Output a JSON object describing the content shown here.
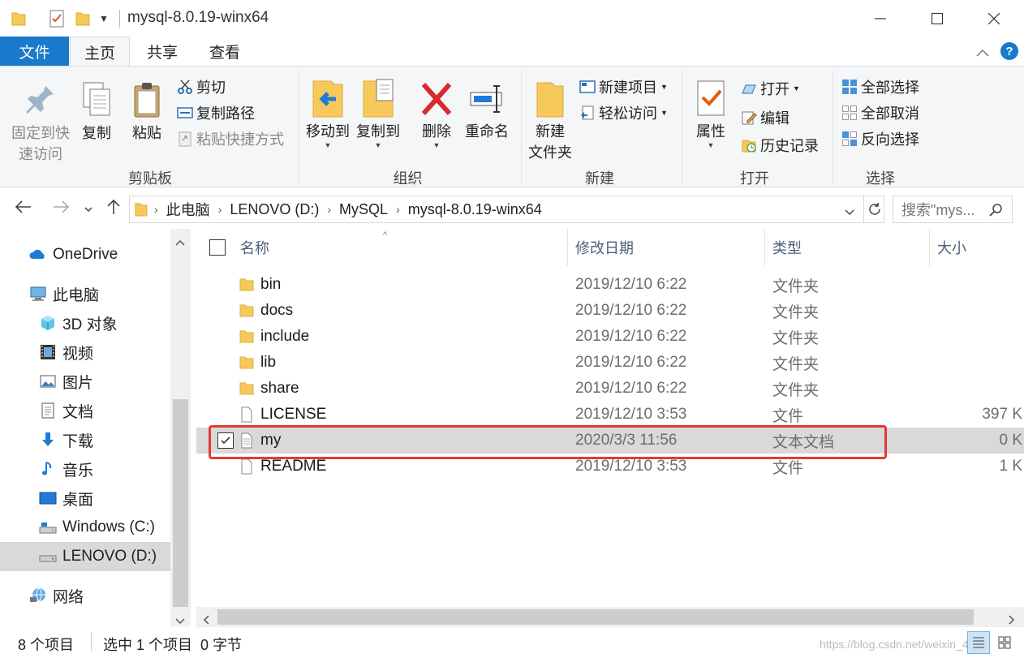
{
  "window": {
    "title": "mysql-8.0.19-winx64",
    "minimize_glyph": "—",
    "maximize_glyph": "☐",
    "close_glyph": "✕"
  },
  "tabs": {
    "file": "文件",
    "home": "主页",
    "share": "共享",
    "view": "查看",
    "help": "?"
  },
  "ribbon": {
    "clipboard": {
      "label": "剪贴板",
      "pin_line1": "固定到快",
      "pin_line2": "速访问",
      "copy": "复制",
      "paste": "粘贴",
      "cut": "剪切",
      "copy_path": "复制路径",
      "paste_shortcut": "粘贴快捷方式"
    },
    "organize": {
      "label": "组织",
      "move_to": "移动到",
      "copy_to": "复制到",
      "delete": "删除",
      "rename": "重命名"
    },
    "new": {
      "label": "新建",
      "new_folder_line1": "新建",
      "new_folder_line2": "文件夹",
      "new_item": "新建项目",
      "easy_access": "轻松访问"
    },
    "open": {
      "label": "打开",
      "properties": "属性",
      "open": "打开",
      "edit": "编辑",
      "history": "历史记录"
    },
    "select": {
      "label": "选择",
      "select_all": "全部选择",
      "select_none": "全部取消",
      "invert": "反向选择"
    }
  },
  "address": {
    "crumbs": [
      "此电脑",
      "LENOVO (D:)",
      "MySQL",
      "mysql-8.0.19-winx64"
    ],
    "search_placeholder": "搜索\"mys..."
  },
  "nav": {
    "items": [
      {
        "label": "OneDrive",
        "icon": "onedrive-icon"
      },
      {
        "label": "此电脑",
        "icon": "computer-icon"
      },
      {
        "label": "3D 对象",
        "icon": "3d-objects-icon"
      },
      {
        "label": "视频",
        "icon": "video-icon"
      },
      {
        "label": "图片",
        "icon": "pictures-icon"
      },
      {
        "label": "文档",
        "icon": "documents-icon"
      },
      {
        "label": "下载",
        "icon": "download-icon"
      },
      {
        "label": "音乐",
        "icon": "music-icon"
      },
      {
        "label": "桌面",
        "icon": "desktop-icon"
      },
      {
        "label": "Windows (C:)",
        "icon": "drive-icon"
      },
      {
        "label": "LENOVO (D:)",
        "icon": "drive-icon"
      },
      {
        "label": "网络",
        "icon": "network-icon"
      }
    ]
  },
  "columns": {
    "name": "名称",
    "date": "修改日期",
    "type": "类型",
    "size": "大小"
  },
  "files": [
    {
      "name": "bin",
      "date": "2019/12/10 6:22",
      "type": "文件夹",
      "size": "",
      "icon": "folder-icon"
    },
    {
      "name": "docs",
      "date": "2019/12/10 6:22",
      "type": "文件夹",
      "size": "",
      "icon": "folder-icon"
    },
    {
      "name": "include",
      "date": "2019/12/10 6:22",
      "type": "文件夹",
      "size": "",
      "icon": "folder-icon"
    },
    {
      "name": "lib",
      "date": "2019/12/10 6:22",
      "type": "文件夹",
      "size": "",
      "icon": "folder-icon"
    },
    {
      "name": "share",
      "date": "2019/12/10 6:22",
      "type": "文件夹",
      "size": "",
      "icon": "folder-icon"
    },
    {
      "name": "LICENSE",
      "date": "2019/12/10 3:53",
      "type": "文件",
      "size": "397 K",
      "icon": "file-icon"
    },
    {
      "name": "my",
      "date": "2020/3/3 11:56",
      "type": "文本文档",
      "size": "0 K",
      "icon": "text-file-icon",
      "selected": true
    },
    {
      "name": "README",
      "date": "2019/12/10 3:53",
      "type": "文件",
      "size": "1 K",
      "icon": "file-icon"
    }
  ],
  "status": {
    "count": "8 个项目",
    "selection": "选中 1 个项目  0 字节"
  },
  "watermark": "https://blog.csdn.net/weixin_4",
  "colors": {
    "accent": "#1979ca",
    "selection": "#d9d9d9",
    "highlight_box": "#e53935",
    "folder": "#f6c95a"
  }
}
